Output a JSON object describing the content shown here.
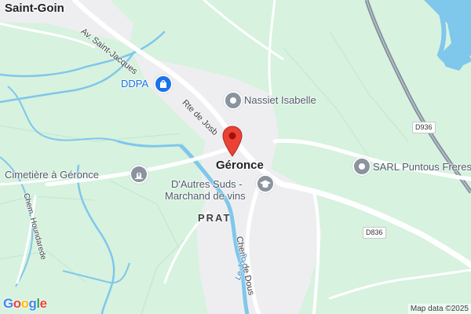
{
  "map": {
    "places": {
      "saint_goin": "Saint-Goin",
      "geronce": "Géronce",
      "prat": "PRAT"
    },
    "pois": {
      "ddpa": "DDPA",
      "nassiet": "Nassiet Isabelle",
      "cemetery": "Cimetière à Géronce",
      "puntous": "SARL Puntous Freres",
      "wine_line1": "D'Autres Suds -",
      "wine_line2": "Marchand de vins"
    },
    "roads": {
      "av_saint_jacques": "Av. Saint-Jacques",
      "rte_de_josb": "Rte de Josb",
      "chem_houndarede": "Chem. Houndarede",
      "chem_de_dous": "Chem. de Dous",
      "d936": "D936",
      "d836": "D836"
    },
    "rivers": {
      "le_joos": "Le Joos"
    },
    "colors": {
      "land": "#d7f2df",
      "built_up": "#eeeef1",
      "road": "#ffffff",
      "water": "#7fc7eb",
      "rail": "#7e8a96",
      "pin": "#ea4335",
      "poi_gray": "#8a949e",
      "poi_blue": "#1a73e8"
    },
    "icons": {
      "main_marker": "red-location-pin-icon",
      "ddpa": "shopping-bag-icon",
      "nassiet": "generic-poi-icon",
      "cemetery": "cemetery-icon",
      "puntous": "generic-poi-icon",
      "wine": "education-cap-icon"
    },
    "attribution": "Map data ©2025",
    "logo": "Google"
  }
}
